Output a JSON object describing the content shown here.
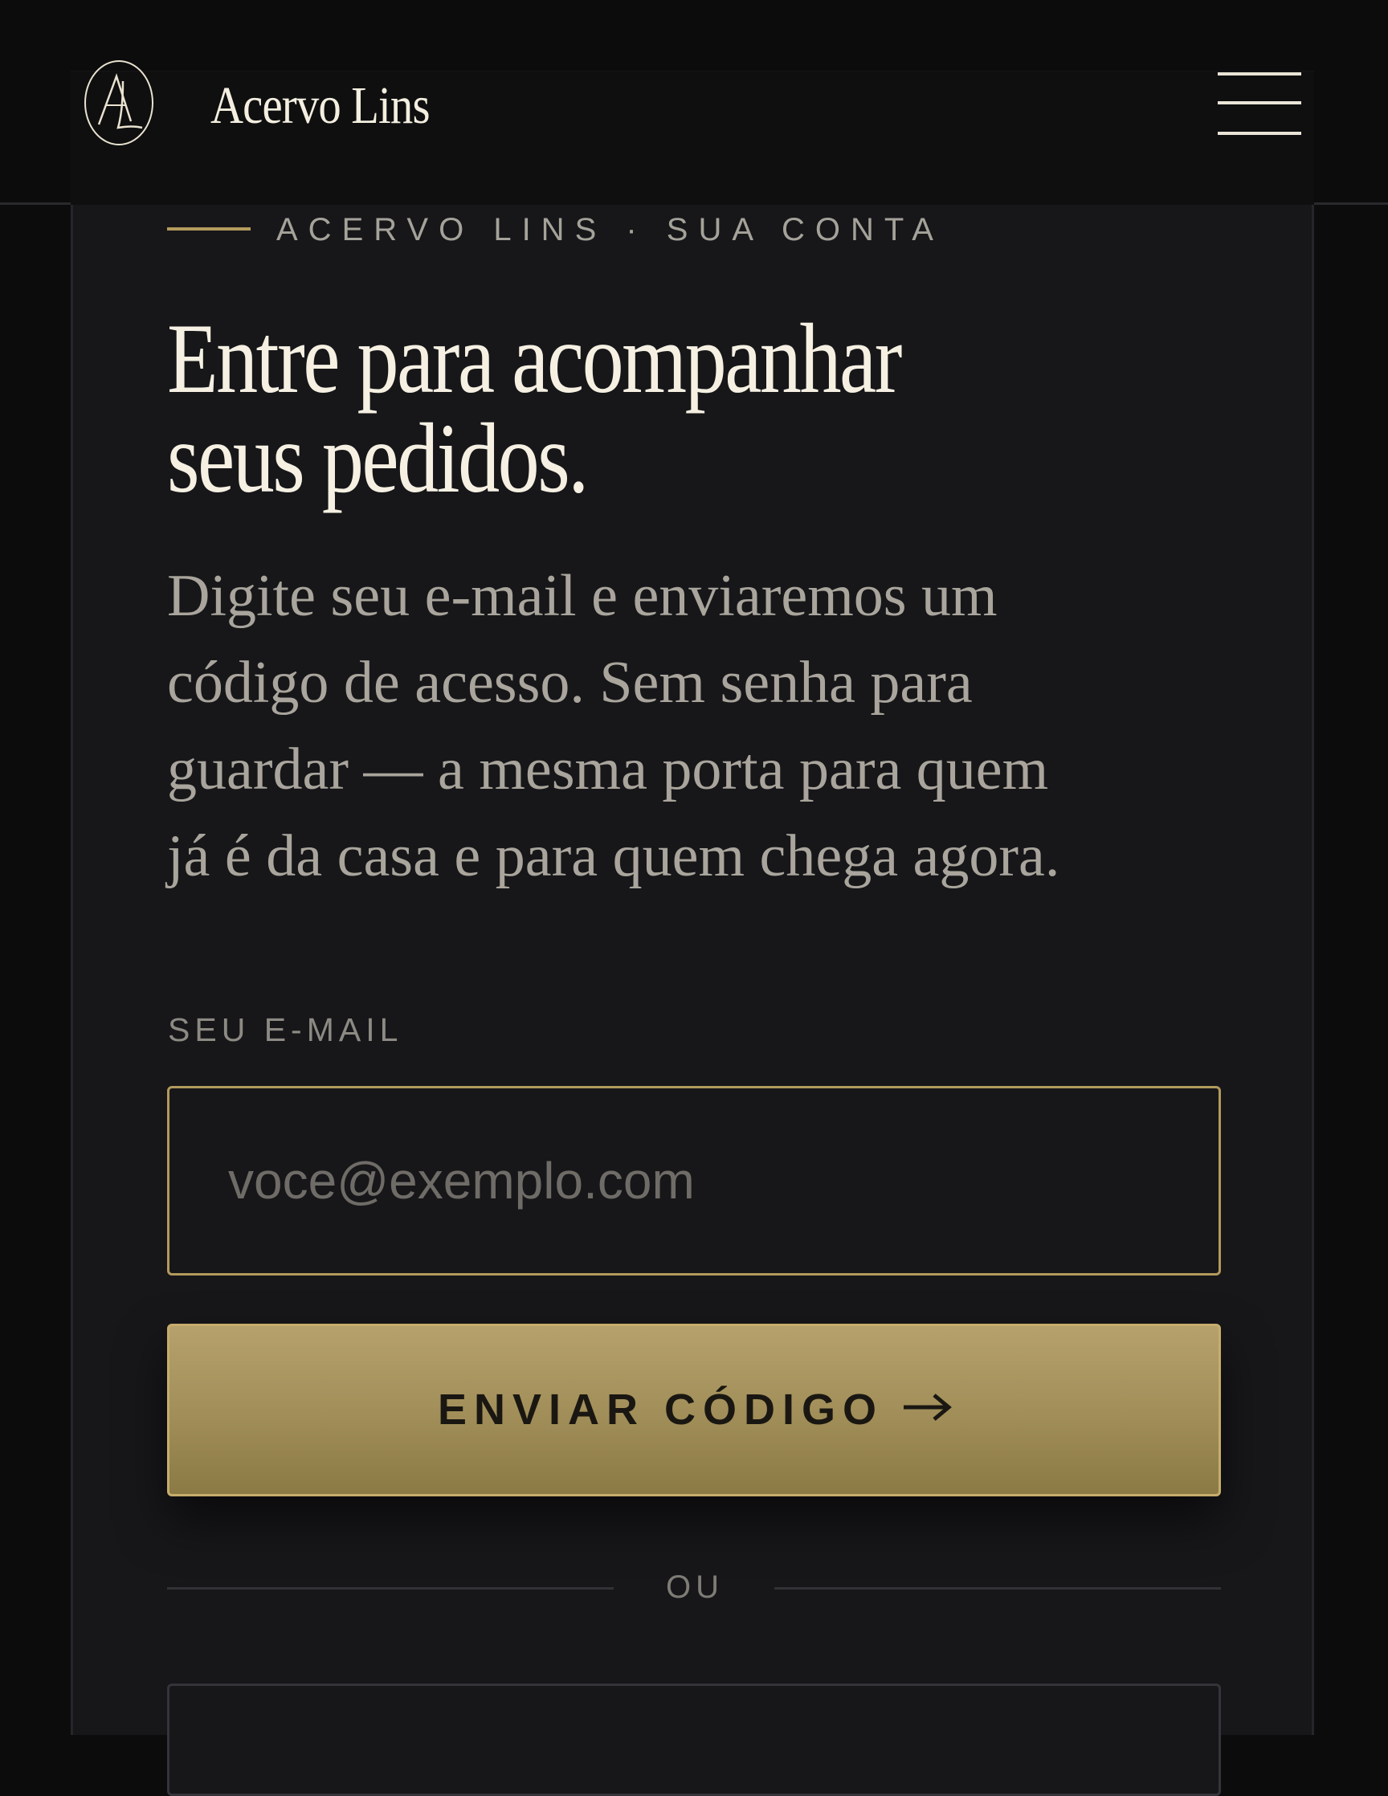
{
  "header": {
    "brand": "Acervo Lins",
    "logo_icon": "al-monogram-icon",
    "menu_icon": "hamburger-menu-icon"
  },
  "eyebrow": "ACERVO LINS · SUA CONTA",
  "title": {
    "line1": "Entre para acompanhar",
    "line2": "seus pedidos."
  },
  "intro": {
    "line1": "Digite seu e-mail e enviaremos um",
    "line2": "código de acesso. Sem senha para",
    "line3": "guardar — a mesma porta para quem",
    "line4": "já é da casa e para quem chega agora."
  },
  "form": {
    "email_label": "SEU E-MAIL",
    "email_placeholder": "voce@exemplo.com",
    "email_value": "",
    "submit_label": "ENVIAR CÓDIGO",
    "submit_icon": "arrow-right-icon"
  },
  "divider": "OU",
  "colors": {
    "background": "#0c0c0d",
    "card": "#17171a",
    "accent_gold": "#b29a5c",
    "heading": "#f5f0e2",
    "body_text": "#a9a59c"
  }
}
